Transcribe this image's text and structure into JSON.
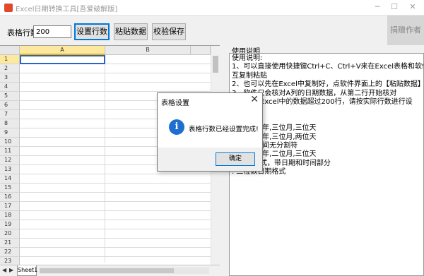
{
  "window": {
    "title": "Excel日期转换工具[吾爱破解版]",
    "minimize": "─",
    "maximize": "☐",
    "close": "✕"
  },
  "toolbar": {
    "rows_label": "表格行数",
    "rows_value": "200",
    "set_rows_button": "设置行数",
    "paste_button": "粘贴数据",
    "verify_save_button": "校验保存",
    "donate_button": "捐赠作者"
  },
  "grid": {
    "columns": [
      "A",
      "B"
    ],
    "rows": [
      "1",
      "2",
      "3",
      "4",
      "5",
      "6",
      "7",
      "8",
      "9",
      "10",
      "11",
      "12",
      "13",
      "14",
      "15",
      "16",
      "17",
      "18",
      "19",
      "20",
      "21",
      "22",
      "23"
    ],
    "sheet_tab": "Sheet1",
    "nav_prev": "◀",
    "nav_next": "▶"
  },
  "help": {
    "caption": "使用说明",
    "lines": [
      "使用说明:",
      "1、可以直接使用快捷键Ctrl+C、Ctrl+V来在Excel表格和软件之间相",
      "互复制粘贴",
      "2、也可以先在Excel中复制好，点软件界面上的【粘贴数据】按钮",
      "3、软件只会核对A列的日期数据，从第二行开始核对",
      "        行，如果Excel中的数据超过200行，请按实际行数进行设",
      "",
      "      式如下：",
      "        格式,四位年,三位月,三位天",
      "        格式,四位年,三位月,两位天",
      "        格式,日期间无分割符",
      "        格式,四位年,二位月,三位天",
      "        的日期格式，带日期和时间部分",
      "    .  二位数日期格式"
    ]
  },
  "dialog": {
    "title": "表格设置",
    "close": "✕",
    "icon": "i",
    "message": "表格行数已经设置完成!",
    "ok_button": "确定"
  },
  "colors": {
    "accent": "#0078d7",
    "info_icon": "#1f6fd0",
    "selected_header": "#fde8a0"
  }
}
